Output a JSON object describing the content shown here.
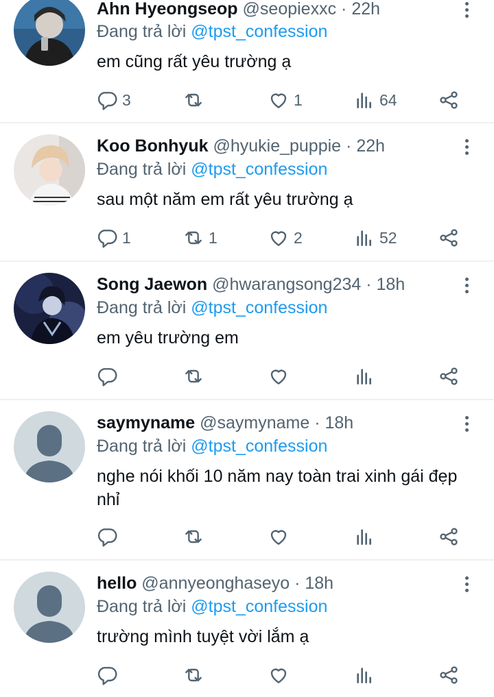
{
  "replies": [
    {
      "name": "Ahn Hyeongseop",
      "handle": "@seopiexxc",
      "separator": "·",
      "time": "22h",
      "replying_label": "Đang trả lời",
      "mention": "@tpst_confession",
      "text": "em cũng rất yêu trường ạ",
      "reply_count": "3",
      "retweet_count": "",
      "like_count": "1",
      "view_count": "64",
      "avatar_type": "photo",
      "avatar_colors": [
        "#2f5f8a",
        "#d6cfc8"
      ]
    },
    {
      "name": "Koo Bonhyuk",
      "handle": "@hyukie_puppie",
      "separator": "·",
      "time": "22h",
      "replying_label": "Đang trả lời",
      "mention": "@tpst_confession",
      "text": "sau một năm em rất yêu trường ạ",
      "reply_count": "1",
      "retweet_count": "1",
      "like_count": "2",
      "view_count": "52",
      "avatar_type": "photo",
      "avatar_colors": [
        "#e9e6e4",
        "#e6c9a6"
      ]
    },
    {
      "name": "Song Jaewon",
      "handle": "@hwarangsong234",
      "separator": "·",
      "time": "18h",
      "replying_label": "Đang trả lời",
      "mention": "@tpst_confession",
      "text": "em yêu trường em",
      "reply_count": "",
      "retweet_count": "",
      "like_count": "",
      "view_count": "",
      "avatar_type": "photo",
      "avatar_colors": [
        "#1a2140",
        "#9fb3d9"
      ]
    },
    {
      "name": "saymyname",
      "handle": "@saymyname",
      "separator": "·",
      "time": "18h",
      "replying_label": "Đang trả lời",
      "mention": "@tpst_confession",
      "text": "nghe nói khối 10 năm nay toàn trai xinh gái đẹp nhỉ",
      "reply_count": "",
      "retweet_count": "",
      "like_count": "",
      "view_count": "",
      "avatar_type": "default",
      "avatar_colors": [
        "#cfd9de",
        "#5b7083"
      ]
    },
    {
      "name": "hello",
      "handle": "@annyeonghaseyo",
      "separator": "·",
      "time": "18h",
      "replying_label": "Đang trả lời",
      "mention": "@tpst_confession",
      "text": "trường mình tuyệt vời lắm ạ",
      "reply_count": "",
      "retweet_count": "",
      "like_count": "",
      "view_count": "",
      "avatar_type": "default",
      "avatar_colors": [
        "#cfd9de",
        "#5b7083"
      ]
    }
  ],
  "icons": {
    "reply": "reply-icon",
    "retweet": "retweet-icon",
    "like": "heart-icon",
    "views": "views-icon",
    "share": "share-icon",
    "more": "more-vertical-icon"
  },
  "colors": {
    "mention": "#1d9bf0",
    "secondary": "#536471",
    "divider": "#eef0f2"
  }
}
